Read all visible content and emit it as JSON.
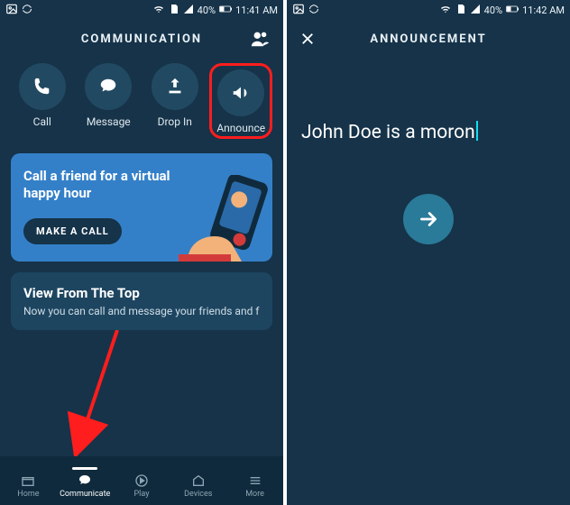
{
  "status": {
    "battery_pct": "40%",
    "time_left": "11:41 AM",
    "time_right": "11:42 AM"
  },
  "left": {
    "title": "COMMUNICATION",
    "actions": {
      "call": "Call",
      "message": "Message",
      "dropin": "Drop In",
      "announce": "Announce"
    },
    "promo": {
      "headline": "Call a friend for a virtual happy hour",
      "cta": "MAKE A CALL"
    },
    "info": {
      "title": "View From The Top",
      "body": "Now you can call and message your friends and family tha"
    },
    "tabs": {
      "home": "Home",
      "communicate": "Communicate",
      "play": "Play",
      "devices": "Devices",
      "more": "More"
    }
  },
  "right": {
    "title": "ANNOUNCEMENT",
    "text": "John Doe is a moron"
  }
}
